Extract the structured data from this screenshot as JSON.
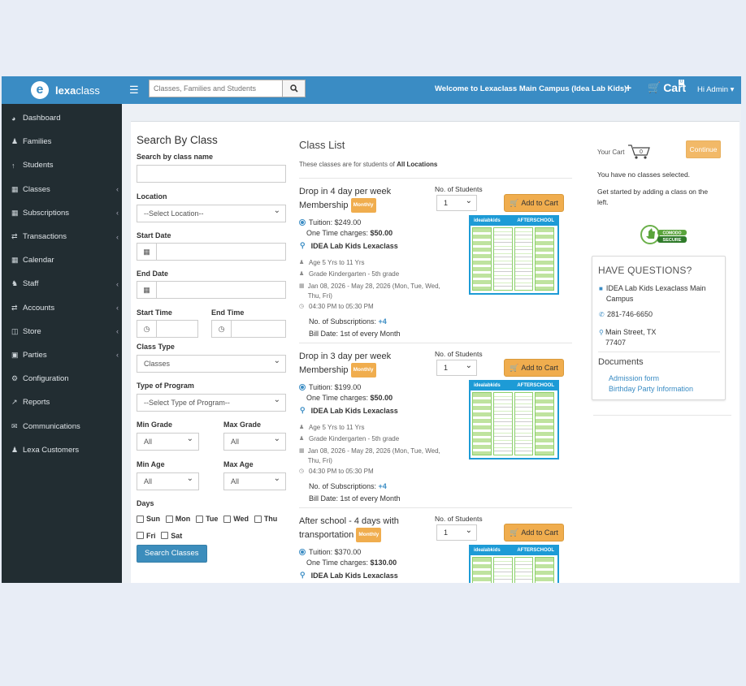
{
  "topbar": {
    "brand_bold": "lexa",
    "brand_light": "class",
    "search_placeholder": "Classes, Families and Students",
    "welcome": "Welcome to Lexaclass Main Campus (Idea Lab Kids)",
    "plus": "+",
    "cart_label": "Cart",
    "cart_count": "0",
    "admin_label": "Hi Admin ▾"
  },
  "sidebar": {
    "items": [
      {
        "label": "Dashboard",
        "icon": "dashboard-icon",
        "chevron": false
      },
      {
        "label": "Families",
        "icon": "users-icon",
        "chevron": false
      },
      {
        "label": "Students",
        "icon": "student-icon",
        "chevron": false
      },
      {
        "label": "Classes",
        "icon": "calendar-icon",
        "chevron": true
      },
      {
        "label": "Subscriptions",
        "icon": "calendar-icon",
        "chevron": true
      },
      {
        "label": "Transactions",
        "icon": "exchange-icon",
        "chevron": true
      },
      {
        "label": "Calendar",
        "icon": "calendar-check-icon",
        "chevron": false
      },
      {
        "label": "Staff",
        "icon": "staff-icon",
        "chevron": true
      },
      {
        "label": "Accounts",
        "icon": "exchange-icon",
        "chevron": true
      },
      {
        "label": "Store",
        "icon": "database-icon",
        "chevron": true
      },
      {
        "label": "Parties",
        "icon": "gift-icon",
        "chevron": true
      },
      {
        "label": "Configuration",
        "icon": "cogs-icon",
        "chevron": false
      },
      {
        "label": "Reports",
        "icon": "chart-icon",
        "chevron": false
      },
      {
        "label": "Communications",
        "icon": "envelope-icon",
        "chevron": false
      },
      {
        "label": "Lexa Customers",
        "icon": "user-icon",
        "chevron": false
      }
    ]
  },
  "search": {
    "title": "Search By Class",
    "class_name_label": "Search by class name",
    "location_label": "Location",
    "location_value": "--Select Location--",
    "start_date_label": "Start Date",
    "end_date_label": "End Date",
    "start_time_label": "Start Time",
    "end_time_label": "End Time",
    "class_type_label": "Class Type",
    "class_type_value": "Classes",
    "program_label": "Type of Program",
    "program_value": "--Select Type of Program--",
    "min_grade_label": "Min Grade",
    "max_grade_label": "Max Grade",
    "min_grade_value": "All",
    "max_grade_value": "All",
    "min_age_label": "Min Age",
    "max_age_label": "Max Age",
    "min_age_value": "All",
    "max_age_value": "All",
    "days_label": "Days",
    "days": [
      "Sun",
      "Mon",
      "Tue",
      "Wed",
      "Thu",
      "Fri",
      "Sat"
    ],
    "button": "Search Classes"
  },
  "class_list": {
    "title": "Class List",
    "note_prefix": "These classes are for students of ",
    "note_bold": "All Locations",
    "students_label": "No. of Students",
    "add_label": "Add to Cart",
    "badge": "Monthly",
    "classes": [
      {
        "name": "Drop in 4 day per week Membership",
        "qty": "1",
        "tuition": "Tuition: $249.00",
        "one_time_label": "One Time charges: ",
        "one_time_value": "$50.00",
        "location": "IDEA Lab Kids Lexaclass",
        "age": "Age 5 Yrs to 11 Yrs",
        "grade": "Grade Kindergarten - 5th grade",
        "dates": "Jan 08, 2026 - May 28, 2026  (Mon, Tue, Wed, Thu, Fri)",
        "time": "04:30 PM to 05:30 PM",
        "subs_label": "No. of Subscriptions: ",
        "subs_value": "+4",
        "bill": "Bill Date: 1st of every Month"
      },
      {
        "name": "Drop in 3 day per week Membership",
        "qty": "1",
        "tuition": "Tuition: $199.00",
        "one_time_label": "One Time charges: ",
        "one_time_value": "$50.00",
        "location": "IDEA Lab Kids Lexaclass",
        "age": "Age 5 Yrs to 11 Yrs",
        "grade": "Grade Kindergarten - 5th grade",
        "dates": "Jan 08, 2026 - May 28, 2026  (Mon, Tue, Wed, Thu, Fri)",
        "time": "04:30 PM to 05:30 PM",
        "subs_label": "No. of Subscriptions: ",
        "subs_value": "+4",
        "bill": "Bill Date: 1st of every Month"
      },
      {
        "name": "After school - 4 days with transportation",
        "qty": "1",
        "tuition": "Tuition: $370.00",
        "one_time_label": "One Time charges: ",
        "one_time_value": "$130.00",
        "location": "IDEA Lab Kids Lexaclass"
      }
    ],
    "flyer_brand": "idealabkids",
    "flyer_title": "AFTERSCHOOL"
  },
  "cart": {
    "your_cart": "Your Cart",
    "count": "0",
    "continue": "Continue",
    "empty": "You have no classes selected.",
    "hint": "Get started by adding a class on the left.",
    "comodo_top": "COMODO",
    "comodo_bottom": "SECURE"
  },
  "questions": {
    "title": "HAVE QUESTIONS?",
    "org": "IDEA Lab Kids Lexaclass Main Campus",
    "phone": "281-746-6650",
    "address": "Main Street, TX  77407",
    "docs_title": "Documents",
    "docs": [
      "Admission form",
      "Birthday Party Information"
    ]
  },
  "colors": {
    "header": "#3a8cc4",
    "sidebar": "#222d32",
    "warning": "#f0ad4e",
    "primary": "#3c8dbc"
  }
}
